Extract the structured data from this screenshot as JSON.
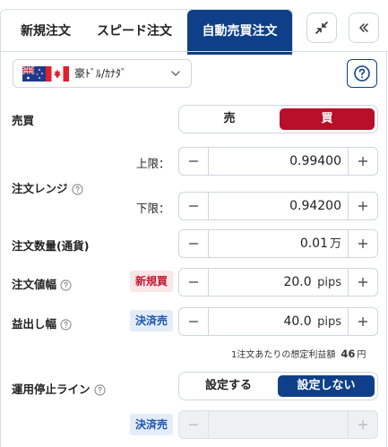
{
  "tabs": [
    {
      "label": "新規注文",
      "active": false
    },
    {
      "label": "スピード注文",
      "active": false
    },
    {
      "label": "自動売買注文",
      "active": true
    }
  ],
  "header_buttons": {
    "collapse_icon": "compress-arrows-icon",
    "hide_icon": "double-chevron-left-icon"
  },
  "currency": {
    "label": "豪ﾄﾞﾙ/ｶﾅﾀﾞ",
    "flags": [
      "australia-flag",
      "canada-flag"
    ]
  },
  "side": {
    "label": "売買",
    "options": [
      "売",
      "買"
    ],
    "selected": "買"
  },
  "range": {
    "label": "注文レンジ",
    "upper": {
      "label": "上限：",
      "value": "0.99400"
    },
    "lower": {
      "label": "下限：",
      "value": "0.94200"
    }
  },
  "quantity": {
    "label": "注文数量(通貨)",
    "value": "0.01",
    "unit": "万"
  },
  "order_width": {
    "label": "注文値幅",
    "badge": "新規買",
    "value": "20.0",
    "unit": "pips"
  },
  "profit_width": {
    "label": "益出し幅",
    "badge": "決済売",
    "value": "40.0",
    "unit": "pips"
  },
  "expected_profit": {
    "label": "1注文あたりの想定利益額",
    "value": "46",
    "unit": "円"
  },
  "stop_line": {
    "label": "運用停止ライン",
    "options": [
      "設定する",
      "設定しない"
    ],
    "selected": "設定しない",
    "badge": "決済売",
    "value": ""
  },
  "colors": {
    "primary": "#0f3f88",
    "buy": "#b8102a",
    "sell_badge": "#1a56b0",
    "buy_badge": "#c0182e"
  }
}
